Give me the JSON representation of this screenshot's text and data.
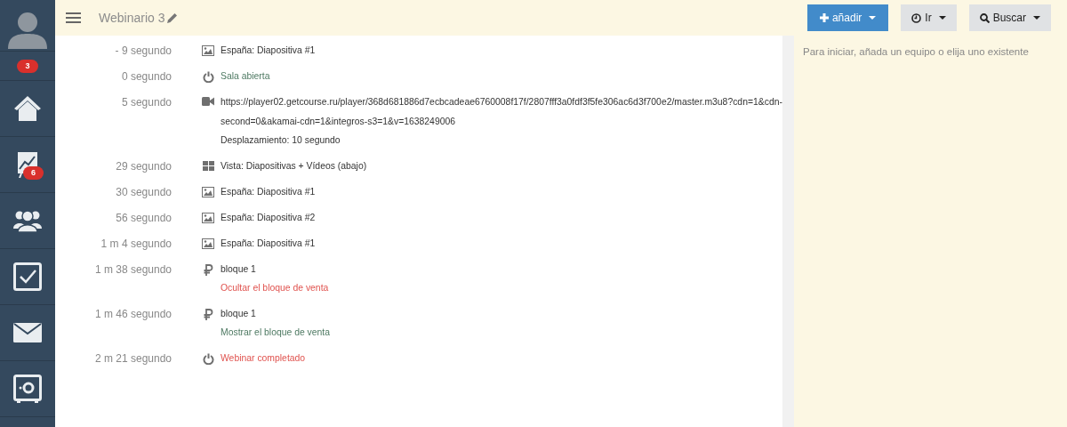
{
  "sidebar": {
    "items": [
      {
        "kind": "avatar"
      },
      {
        "kind": "badge",
        "badge": "3"
      },
      {
        "kind": "home"
      },
      {
        "kind": "chart",
        "badge": "6"
      },
      {
        "kind": "people"
      },
      {
        "kind": "check"
      },
      {
        "kind": "mail"
      },
      {
        "kind": "safe"
      }
    ]
  },
  "header": {
    "title": "Webinario 3",
    "buttons": [
      {
        "label": "añadir",
        "kind": "add"
      },
      {
        "label": "Ir",
        "kind": "go"
      },
      {
        "label": "Buscar",
        "kind": "search"
      }
    ]
  },
  "events": [
    {
      "time": "- 9 segundo",
      "kind": "slide",
      "lines": [
        {
          "text": "España: Diapositiva #1"
        }
      ]
    },
    {
      "time": "0 segundo",
      "kind": "room",
      "lines": [
        {
          "text": "Sala abierta",
          "color": "#4f7a63"
        }
      ]
    },
    {
      "time": "5 segundo",
      "kind": "video",
      "lines": [
        {
          "text": "https://player02.getcourse.ru/player/368d681886d7ecbcadeae6760008f17f/2807fff3a0fdf3f5fe306ac6d3f700e2/master.m3u8?cdn=1&cdn-second=0&akamai-cdn=1&integros-s3=1&v=1638249006"
        },
        {
          "text": "Desplazamiento: 10 segundo"
        }
      ]
    },
    {
      "time": "29 segundo",
      "kind": "layout",
      "lines": [
        {
          "text": "Vista: Diapositivas + Vídeos (abajo)"
        }
      ]
    },
    {
      "time": "30 segundo",
      "kind": "slide",
      "lines": [
        {
          "text": "España: Diapositiva #1"
        }
      ]
    },
    {
      "time": "56 segundo",
      "kind": "slide",
      "lines": [
        {
          "text": "España: Diapositiva #2"
        }
      ]
    },
    {
      "time": "1 m 4 segundo",
      "kind": "slide",
      "lines": [
        {
          "text": "España: Diapositiva #1"
        }
      ]
    },
    {
      "time": "1 m 38 segundo",
      "kind": "sale",
      "lines": [
        {
          "text": "bloque 1"
        },
        {
          "text": "Ocultar el bloque de venta",
          "color": "#e0534f"
        }
      ]
    },
    {
      "time": "1 m 46 segundo",
      "kind": "sale",
      "lines": [
        {
          "text": "bloque 1"
        },
        {
          "text": "Mostrar el bloque de venta",
          "color": "#4f7a63"
        }
      ]
    },
    {
      "time": "2 m 21 segundo",
      "kind": "room",
      "lines": [
        {
          "text": "Webinar completado",
          "color": "#e0534f"
        }
      ]
    }
  ],
  "panel": {
    "text": "Para iniciar, añada un equipo o elija uno existente"
  }
}
